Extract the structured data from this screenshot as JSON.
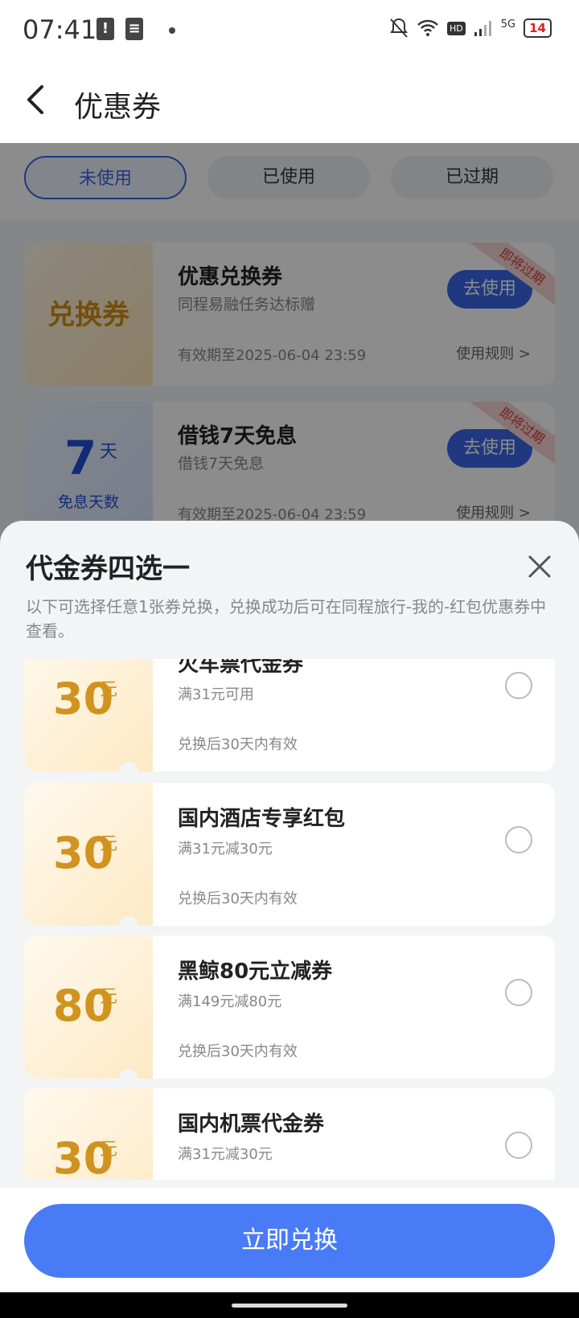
{
  "status_bar": {
    "time": "07:41",
    "network": "5G",
    "hd": "HD",
    "battery": "14"
  },
  "header": {
    "title": "优惠券"
  },
  "tabs": [
    {
      "label": "未使用",
      "active": true
    },
    {
      "label": "已使用",
      "active": false
    },
    {
      "label": "已过期",
      "active": false
    }
  ],
  "background_coupons": [
    {
      "left_text": "兑换券",
      "title": "优惠兑换券",
      "subtitle": "同程易融任务达标赠",
      "expiry": "有效期至2025-06-04 23:59",
      "rule": "使用规则 >",
      "button": "去使用",
      "ribbon": "即将过期"
    },
    {
      "left_number": "7",
      "left_unit": "天",
      "left_label": "免息天数",
      "title": "借钱7天免息",
      "subtitle": "借钱7天免息",
      "expiry": "有效期至2025-06-04 23:59",
      "rule": "使用规则 >",
      "button": "去使用",
      "ribbon": "即将过期"
    }
  ],
  "sheet": {
    "title": "代金券四选一",
    "description": "以下可选择任意1张券兑换，兑换成功后可在同程旅行-我的-红包优惠券中查看。",
    "coupons": [
      {
        "amount": "30",
        "unit": "元",
        "title": "火车票代金券",
        "condition": "满31元可用",
        "validity": "兑换后30天内有效"
      },
      {
        "amount": "30",
        "unit": "元",
        "title": "国内酒店专享红包",
        "condition": "满31元减30元",
        "validity": "兑换后30天内有效"
      },
      {
        "amount": "80",
        "unit": "元",
        "title": "黑鲸80元立减券",
        "condition": "满149元减80元",
        "validity": "兑换后30天内有效"
      },
      {
        "amount": "30",
        "unit": "元",
        "title": "国内机票代金券",
        "condition": "满31元减30元",
        "validity": ""
      }
    ],
    "redeem_button": "立即兑换"
  }
}
